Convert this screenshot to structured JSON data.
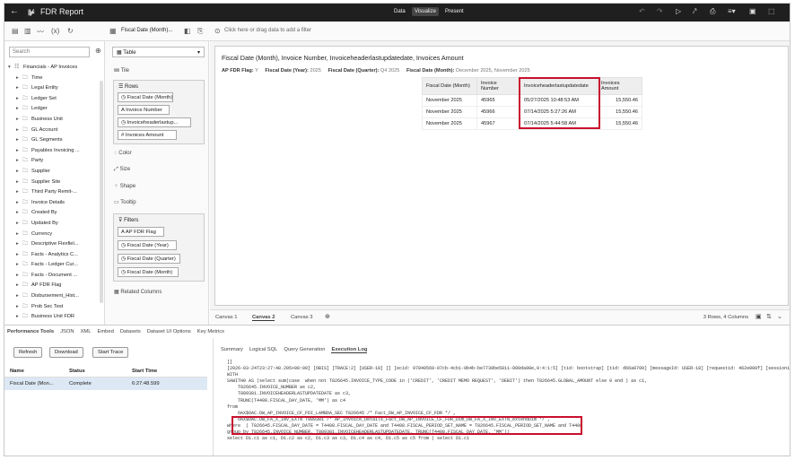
{
  "header": {
    "title": "FDR Report",
    "modes": [
      "Data",
      "Visualize",
      "Present"
    ],
    "active_mode": "Visualize"
  },
  "data_panel": {
    "search_placeholder": "Search",
    "tree_root": "Financials - AP Invoices",
    "tree_items": [
      "Time",
      "Legal Entity",
      "Ledger Set",
      "Ledger",
      "Business Unit",
      "GL Account",
      "GL Segments",
      "Payables Invoicing ...",
      "Party",
      "Supplier",
      "Supplier Site",
      "Third Party Remit-...",
      "Invoice Details",
      "Created By",
      "Updated By",
      "Currency",
      "Descriptive Flexfiel...",
      "Facts - Analytics C...",
      "Facts - Ledger Cur...",
      "Facts - Document ...",
      "AP FDR Flag",
      "Disbursement_Hist...",
      "Prob Sec Test",
      "Business Unit FDR"
    ]
  },
  "grammar": {
    "viz_name": "Fiscal Date (Month)...",
    "viz_type": "Table",
    "tile": "Tile",
    "rows_label": "Rows",
    "rows": [
      "Fiscal Date (Month)",
      "Invoice Number",
      "Invoiceheaderlastup...",
      "Invoices Amount"
    ],
    "color": "Color",
    "size": "Size",
    "shape": "Shape",
    "tooltip": "Tooltip",
    "filters_label": "Filters",
    "filters": [
      "AP FDR Flag",
      "Fiscal Date (Year)",
      "Fiscal Date (Quarter)",
      "Fiscal Date (Month)"
    ],
    "related_columns": "Related Columns"
  },
  "canvas": {
    "filter_placeholder": "Click here or drag data to add a filter",
    "viz_title": "Fiscal Date (Month), Invoice Number, Invoiceheaderlastupdatedate, Invoices Amount",
    "filters": [
      {
        "label": "AP FDR Flag:",
        "value": "Y"
      },
      {
        "label": "Fiscal Date (Year):",
        "value": "2025"
      },
      {
        "label": "Fiscal Date (Quarter):",
        "value": "Q4 2025"
      },
      {
        "label": "Fiscal Date (Month):",
        "value": "December 2025, November 2025"
      }
    ],
    "table": {
      "headers": [
        "Fiscal Date (Month)",
        "Invoice Number",
        "Invoiceheaderlastupdatedate",
        "Invoices Amount"
      ],
      "rows": [
        [
          "November 2025",
          "45965",
          "05/27/2025 10:48:53 AM",
          "15,550.46"
        ],
        [
          "November 2025",
          "45966",
          "07/14/2025 5:27:26 AM",
          "15,550.46"
        ],
        [
          "November 2025",
          "45967",
          "07/14/2025 5:44:58 AM",
          "15,550.46"
        ]
      ]
    },
    "tabs": [
      "Canvas 1",
      "Canvas 2",
      "Canvas 3"
    ],
    "active_tab": "Canvas 2",
    "row_count": "3 Rows, 4 Columns"
  },
  "performance": {
    "tabs": [
      "Performance Tools",
      "JSON",
      "XML",
      "Embed",
      "Datasets",
      "Dataset UI Options",
      "Key Metrics"
    ],
    "buttons": [
      "Refresh",
      "Download",
      "Start Trace"
    ],
    "columns": [
      "Name",
      "Status",
      "Start Time"
    ],
    "row": {
      "name": "Fiscal Date (Mon...",
      "status": "Complete",
      "start_time": "6:27:48.599"
    },
    "detail_tabs": [
      "Summary",
      "Logical SQL",
      "Query Generation",
      "Execution Log"
    ],
    "active_detail_tab": "Execution Log",
    "log_lines": [
      "[]",
      "[2026-03-24T23:27:48.205+00:00] [OBIS] [TRACE:2] [USER-18] [] [ecid: 97840560-07cb-4cb1-9b4b-be7730be5811-000da98e,0:4:1:5] [tid: bootstrap] [tid: d66a0700] [messageId: USER-18] [requestid: 462e000f] [sessionid: 462",
      "WITH",
      "SAWITH0 AS (select sum(case  when not T826645.INVOICE_TYPE_CODE in ('CREDIT', 'CREDIT MEMO REQUEST', 'DEBIT') then T826645.GLOBAL_AMOUNT else 0 end ) as c1,",
      "    T826645.INVOICE_NUMBER as c2,",
      "    T889381.INVOICEHEADERLASTUPDATEDATE as c3,",
      "    TRUNC(T4408.FISCAL_DAY_DATE, 'MM') as c4",
      "from",
      "    OAX$OAC.DW_AP_INVOICE_CF_FDI_LAMBDA_SEC T826645 /* Fact_DW_AP_INVOICE_CF_FDR */ ,",
      "    OAX$OAC.DW_FA_X_INV_EXTN T889381 /* AP_Invoice_Details_Fact_DW_AP_INVOICE_CF_FDR_Dim_DW_FA_X_INV_EXTN_extendDim */ ,",
      "where  ( T826645.FISCAL_DAY_DATE = T4408.FISCAL_DAY_DATE and T4408.FISCAL_PERIOD_SET_NAME = T826645.FISCAL_PERIOD_SET_NAME and T4408",
      "group by T826645.INVOICE_NUMBER, T889381.INVOICEHEADERLASTUPDATEDATE, TRUNC(T4408.FISCAL_DAY_DATE, 'MM'))",
      "select D1.c1 as c1, D1.c2 as c2, D1.c3 as c3, D1.c4 as c4, D1.c5 as c5 from ( select D1.c1"
    ]
  }
}
